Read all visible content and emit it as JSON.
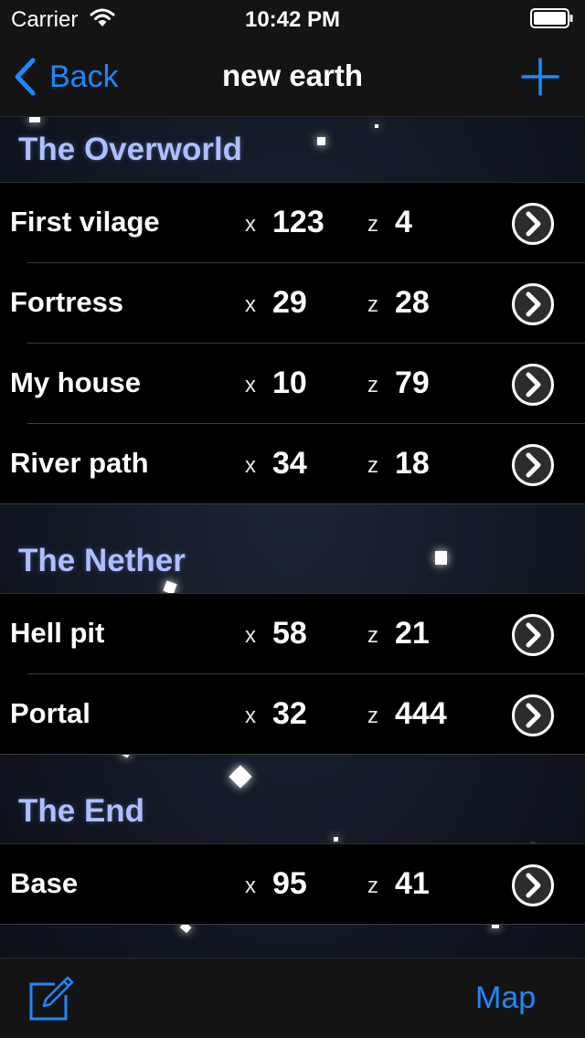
{
  "status_bar": {
    "carrier": "Carrier",
    "time": "10:42 PM"
  },
  "nav": {
    "back_label": "Back",
    "title": "new earth",
    "add_icon": "plus-icon"
  },
  "coord_labels": {
    "x": "x",
    "z": "z"
  },
  "sections": [
    {
      "title": "The Overworld",
      "rows": [
        {
          "name": "First vilage",
          "x": "123",
          "z": "4"
        },
        {
          "name": "Fortress",
          "x": "29",
          "z": "28"
        },
        {
          "name": "My house",
          "x": "10",
          "z": "79"
        },
        {
          "name": "River path",
          "x": "34",
          "z": "18"
        }
      ]
    },
    {
      "title": "The Nether",
      "rows": [
        {
          "name": "Hell pit",
          "x": "58",
          "z": "21"
        },
        {
          "name": "Portal",
          "x": "32",
          "z": "444"
        }
      ]
    },
    {
      "title": "The End",
      "rows": [
        {
          "name": "Base",
          "x": "95",
          "z": "41"
        }
      ]
    }
  ],
  "toolbar": {
    "compose_icon": "compose-icon",
    "map_label": "Map"
  },
  "colors": {
    "accent": "#1e88ff",
    "section_title": "#aebfff",
    "row_background": "#000000",
    "bar_background": "#141414"
  }
}
